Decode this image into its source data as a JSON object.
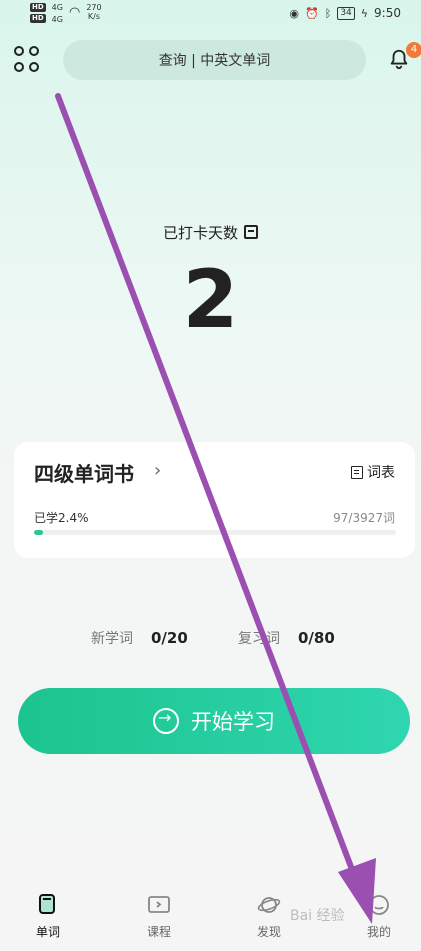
{
  "status_bar": {
    "hd_1": "HD",
    "hd_2": "HD",
    "signal_1": "4G",
    "signal_2": "4G",
    "net_speed_value": "270",
    "net_speed_unit": "K/s",
    "battery": "34",
    "time": "9:50"
  },
  "header": {
    "search_placeholder": "查询 | 中英文单词",
    "notification_count": "4"
  },
  "checkin": {
    "label": "已打卡天数",
    "days": "2"
  },
  "book": {
    "title": "四级单词书",
    "wordlist_label": "词表",
    "learned_percent_text": "已学2.4%",
    "learned_count": "97/3927词",
    "progress": 0.024
  },
  "stats": {
    "new_label": "新学词",
    "new_value": "0/20",
    "review_label": "复习词",
    "review_value": "0/80"
  },
  "start_button": {
    "label": "开始学习"
  },
  "tabbar": {
    "items": [
      {
        "label": "单词"
      },
      {
        "label": "课程"
      },
      {
        "label": "发现"
      },
      {
        "label": "我的"
      }
    ]
  },
  "overlay": {
    "watermark": "Bai 经验"
  },
  "colors": {
    "accent": "#1cc48e",
    "badge": "#f07a3a",
    "arrow": "#9b4fb0"
  }
}
